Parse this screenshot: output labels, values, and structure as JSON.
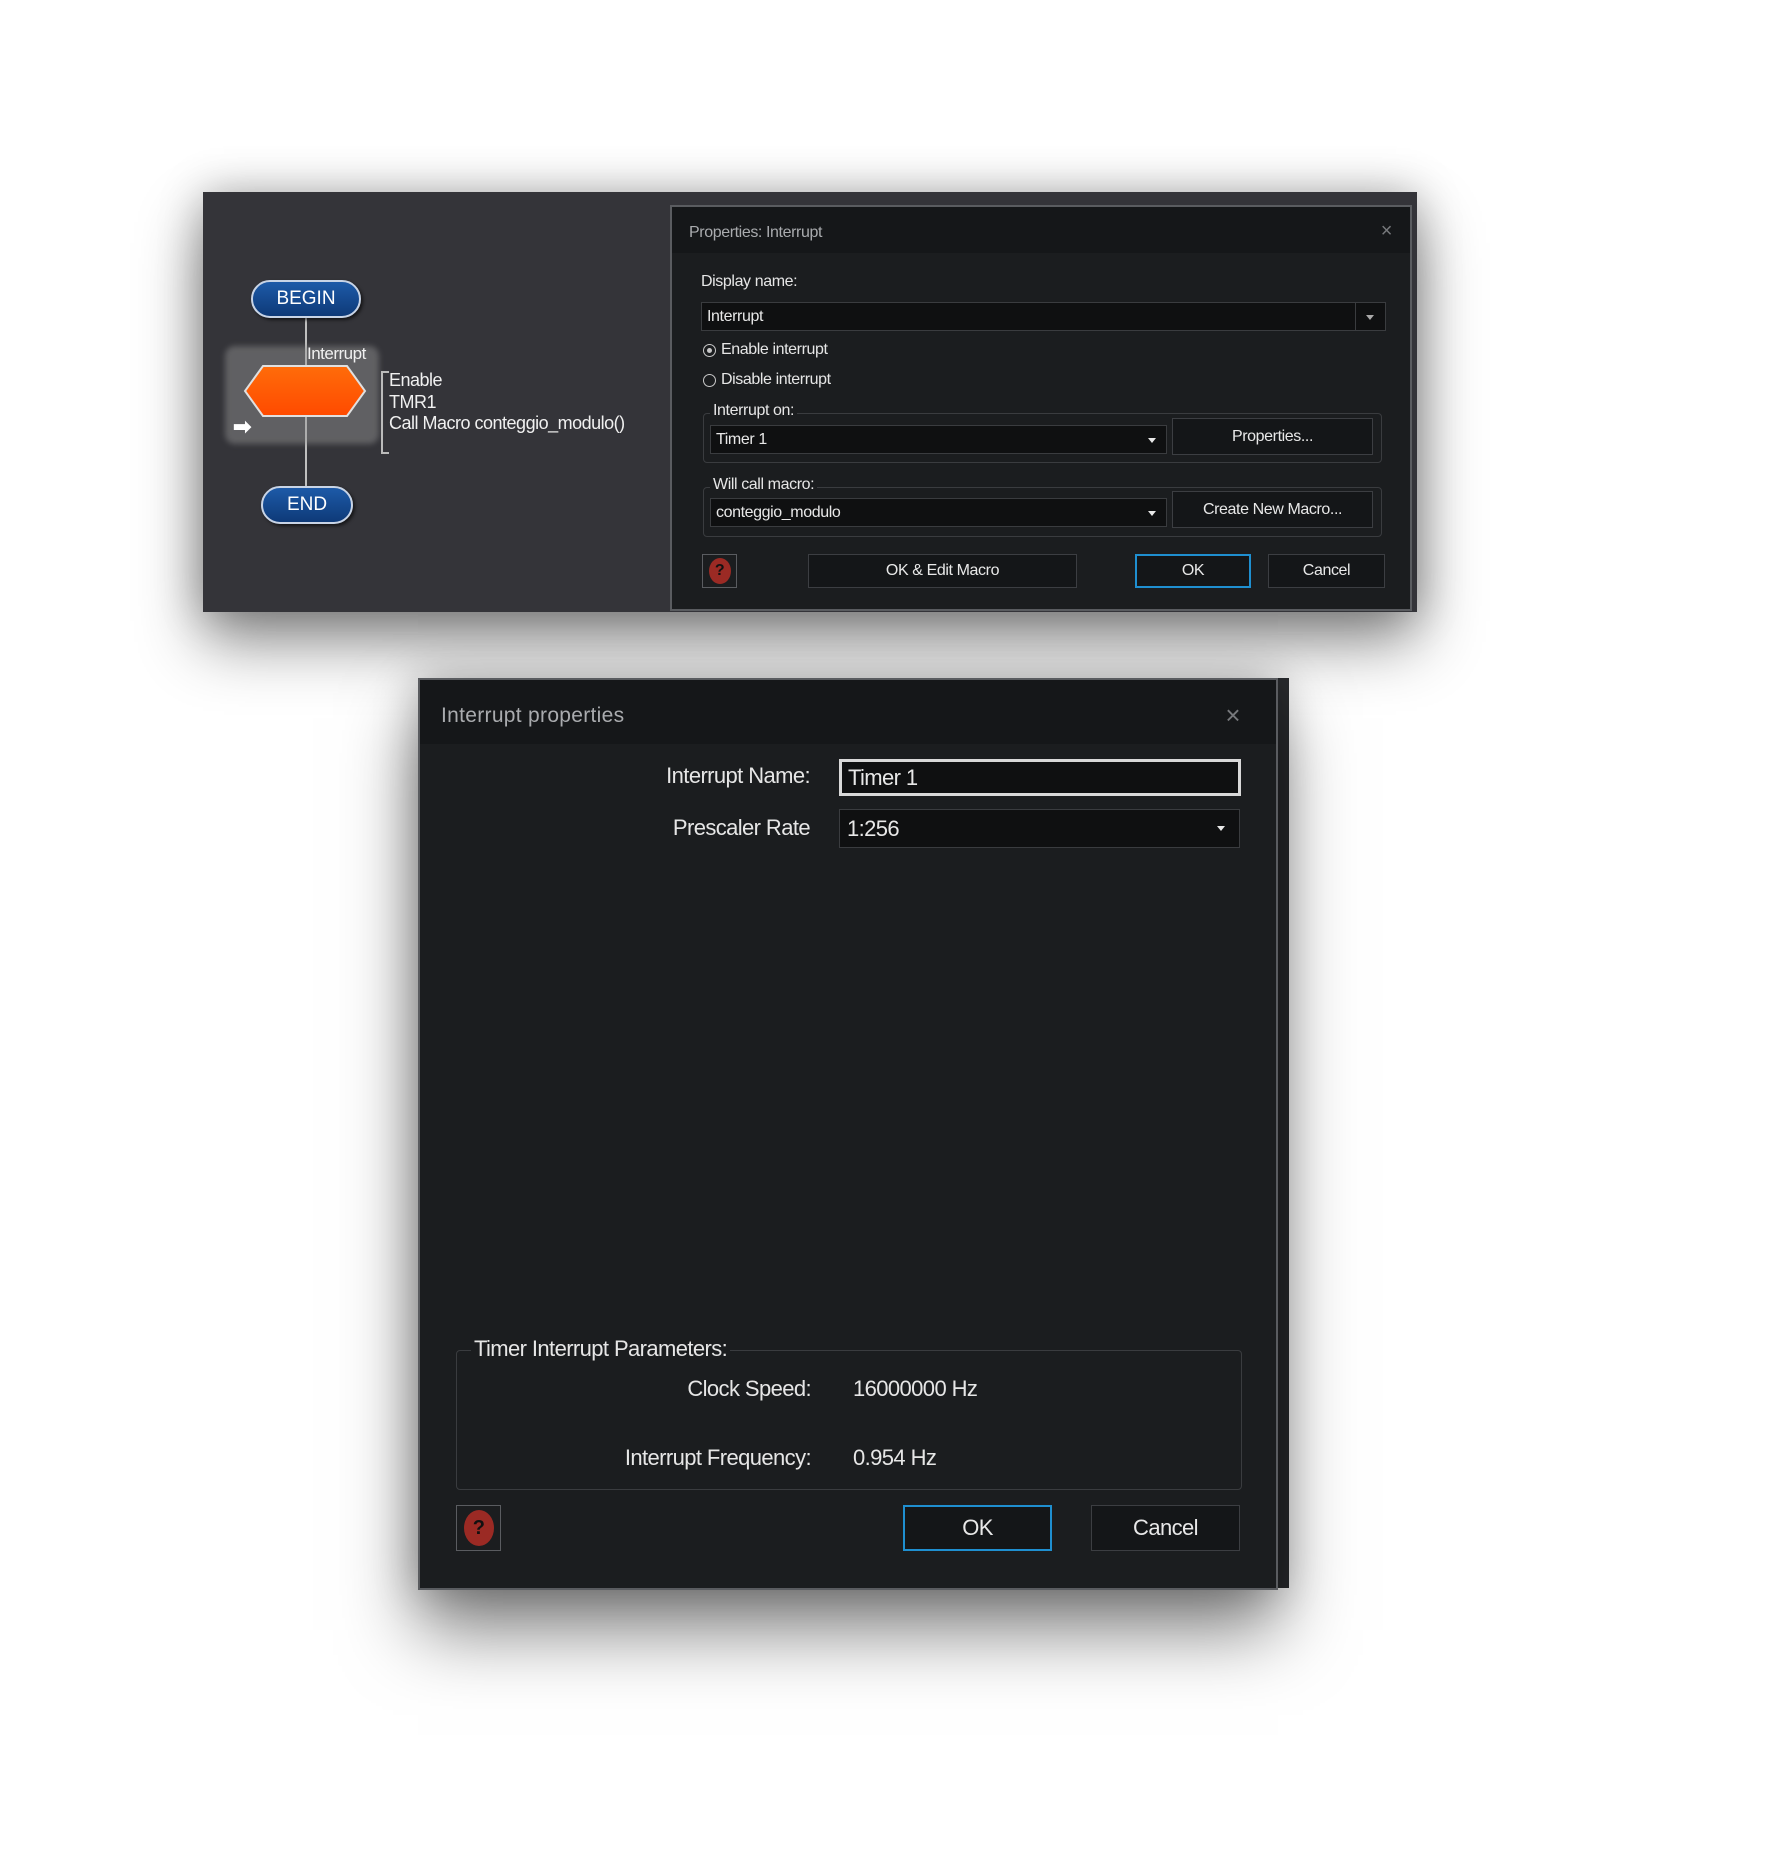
{
  "flowchart": {
    "begin_label": "BEGIN",
    "end_label": "END",
    "icon_caption": "Interrupt",
    "icon_details": [
      "Enable",
      "TMR1",
      "Call Macro conteggio_modulo()"
    ],
    "icon_color": "#ff5a00"
  },
  "properties_dialog": {
    "title": "Properties: Interrupt",
    "display_name_label": "Display name:",
    "display_name_value": "Interrupt",
    "enable_label": "Enable interrupt",
    "disable_label": "Disable interrupt",
    "selected_option": "enable",
    "interrupt_on_label": "Interrupt on:",
    "interrupt_on_value": "Timer 1",
    "properties_button": "Properties...",
    "will_call_macro_label": "Will call macro:",
    "macro_value": "conteggio_modulo",
    "create_macro_button": "Create New Macro...",
    "ok_edit_button": "OK & Edit Macro",
    "ok_button": "OK",
    "cancel_button": "Cancel",
    "help_glyph": "?"
  },
  "interrupt_properties_dialog": {
    "title": "Interrupt properties",
    "name_label": "Interrupt Name:",
    "name_value": "Timer 1",
    "prescaler_label": "Prescaler Rate",
    "prescaler_value": "1:256",
    "group_label": "Timer Interrupt Parameters:",
    "clock_label": "Clock Speed:",
    "clock_value": "16000000 Hz",
    "frequency_label": "Interrupt Frequency:",
    "frequency_value": "0.954 Hz",
    "ok_button": "OK",
    "cancel_button": "Cancel",
    "help_glyph": "?"
  },
  "colors": {
    "accent": "#1f8fd0",
    "help": "#9b2a24",
    "pill": "#0e3a78"
  }
}
